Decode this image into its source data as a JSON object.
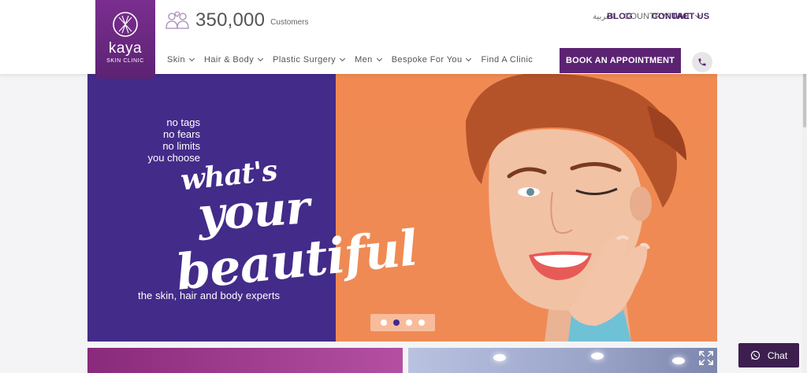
{
  "brand": {
    "name": "kaya",
    "sub": "SKIN CLINIC",
    "color": "#5c2373"
  },
  "header": {
    "customers_count": "350,000",
    "customers_label": "Customers",
    "arabic_label": "العربية",
    "country_label": "COUNTRY/",
    "country_value": "UAE",
    "blog": "BLOG",
    "contact": "CONTACT US"
  },
  "nav": {
    "items": [
      {
        "label": "Skin",
        "has_dropdown": true
      },
      {
        "label": "Hair & Body",
        "has_dropdown": true
      },
      {
        "label": "Plastic Surgery",
        "has_dropdown": true
      },
      {
        "label": "Men",
        "has_dropdown": true
      },
      {
        "label": "Bespoke For You",
        "has_dropdown": true
      },
      {
        "label": "Find A Clinic",
        "has_dropdown": false
      }
    ],
    "book_button": "BOOK AN APPOINTMENT"
  },
  "hero": {
    "tags": [
      "no tags",
      "no fears",
      "no limits",
      "you choose"
    ],
    "script_1": "what's",
    "script_2": "your",
    "script_3": "beautiful",
    "tagline": "the skin, hair and body experts",
    "slides_count": 4,
    "active_slide": 2,
    "left_color": "#432b8a",
    "right_color": "#f08a52"
  },
  "chat": {
    "label": "Chat"
  }
}
